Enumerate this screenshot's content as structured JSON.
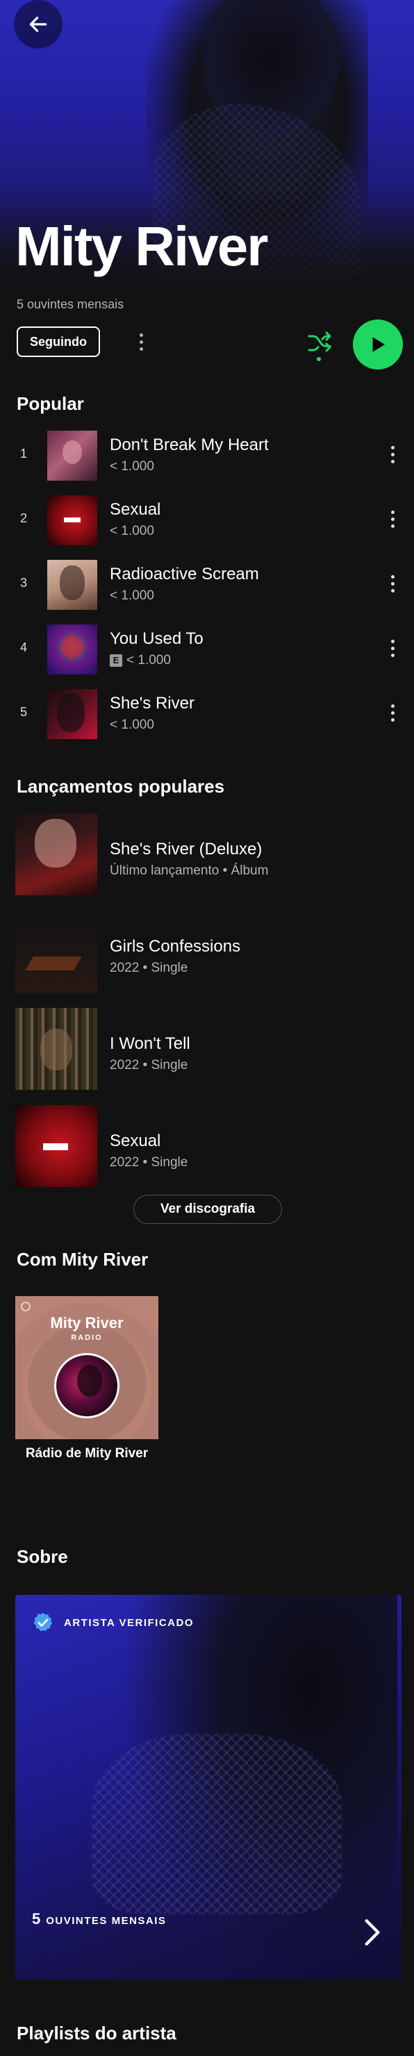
{
  "header": {
    "back_icon": "arrow-left-icon",
    "artist_name": "Mity River",
    "monthly_listeners": "5 ouvintes mensais",
    "follow_label": "Seguindo",
    "accent_color": "#1ed760"
  },
  "popular": {
    "title": "Popular",
    "tracks": [
      {
        "num": "1",
        "title": "Don't Break My Heart",
        "plays": "< 1.000",
        "explicit": false
      },
      {
        "num": "2",
        "title": "Sexual",
        "plays": "< 1.000",
        "explicit": false
      },
      {
        "num": "3",
        "title": "Radioactive Scream",
        "plays": "< 1.000",
        "explicit": false
      },
      {
        "num": "4",
        "title": "You Used To",
        "plays": "< 1.000",
        "explicit": true,
        "explicit_label": "E"
      },
      {
        "num": "5",
        "title": "She's River",
        "plays": "< 1.000",
        "explicit": false
      }
    ]
  },
  "releases": {
    "title": "Lançamentos populares",
    "items": [
      {
        "title": "She's River (Deluxe)",
        "meta": "Último lançamento • Álbum"
      },
      {
        "title": "Girls Confessions",
        "meta": "2022 • Single"
      },
      {
        "title": "I Won't Tell",
        "meta": "2022 • Single"
      },
      {
        "title": "Sexual",
        "meta": "2022 • Single"
      }
    ],
    "discography_label": "Ver discografia"
  },
  "featuring": {
    "title": "Com Mity River",
    "radio_card_name": "Mity River",
    "radio_card_label": "RADIO",
    "radio_caption": "Rádio de Mity River"
  },
  "about": {
    "title": "Sobre",
    "verified_label": "ARTISTA VERIFICADO",
    "listeners_count": "5",
    "listeners_label": "OUVINTES MENSAIS"
  },
  "playlists": {
    "title": "Playlists do artista"
  }
}
